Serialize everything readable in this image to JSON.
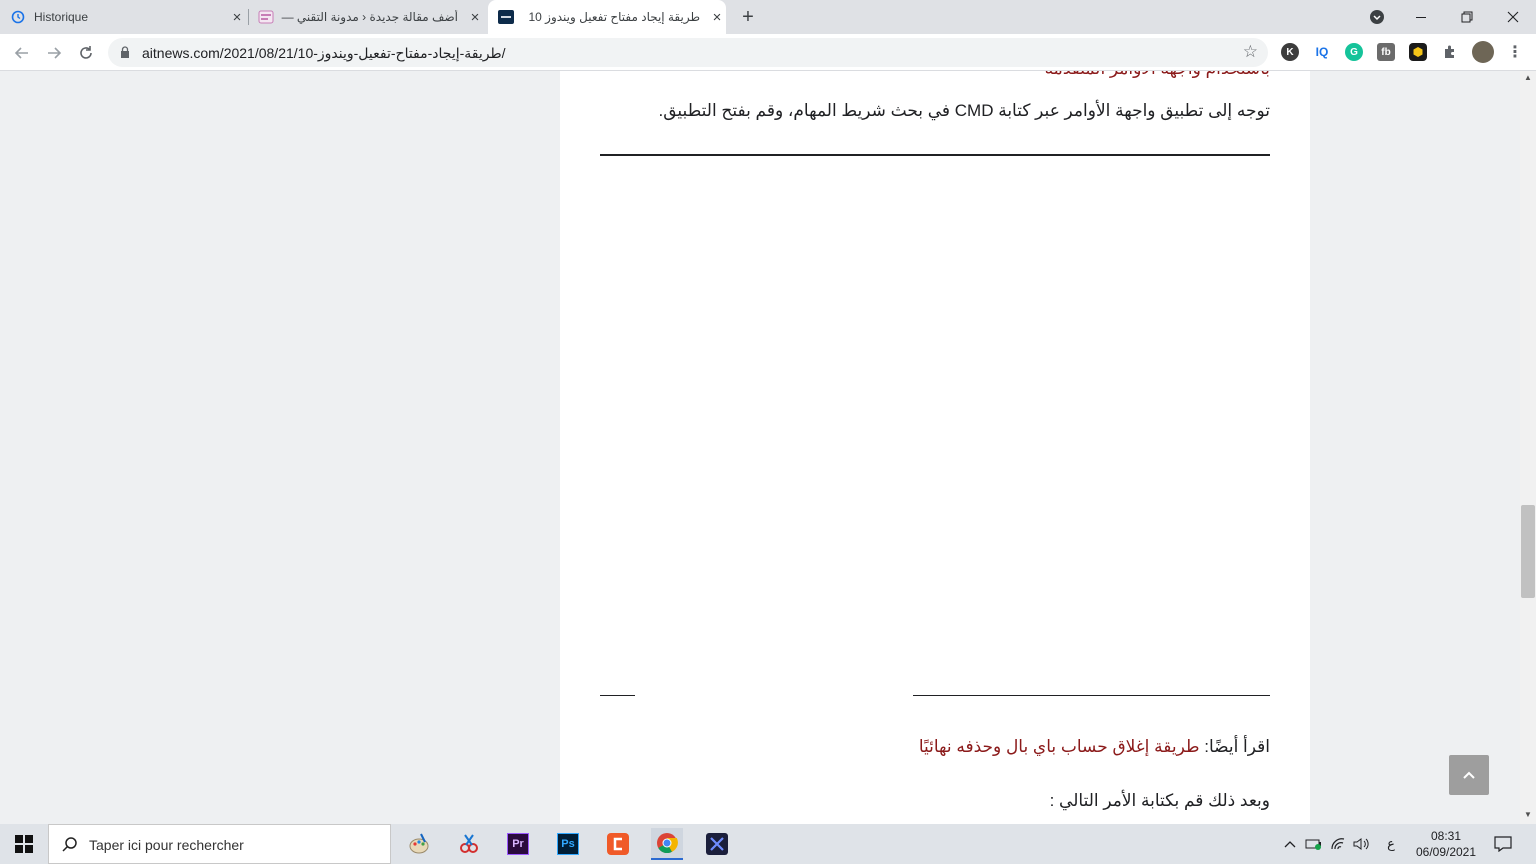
{
  "browser": {
    "tabs": [
      {
        "title": "Historique",
        "favicon": "history-icon",
        "active": false
      },
      {
        "title": "أضف مقالة جديدة ‹ مدونة التقني —",
        "favicon": "aitnews-blog-favicon",
        "active": false
      },
      {
        "title": "طريقة إيجاد مفتاح تفعيل ويندوز 10",
        "favicon": "aitnews-favicon",
        "active": true
      }
    ],
    "new_tab": "+",
    "url": "aitnews.com/2021/08/21/10-طريقة-إيجاد-مفتاح-تفعيل-ويندوز/",
    "extensions": [
      "K",
      "IQ",
      "G",
      "fb",
      "",
      ""
    ]
  },
  "article": {
    "cut_heading": "باستخدام واجهة الأوامر المتقدمة",
    "para1": "توجه إلى تطبيق واجهة الأوامر عبر كتابة CMD في بحث شريط المهام، وقم بفتح التطبيق.",
    "read_also_label": "اقرأ أيضًا:",
    "read_also_link": "طريقة إغلاق حساب باي بال وحذفه نهائيًا",
    "para2": "وبعد ذلك قم بكتابة الأمر التالي :",
    "colors": {
      "link": "#8b1a1a",
      "text": "#202124"
    }
  },
  "taskbar": {
    "search_placeholder": "Taper ici pour rechercher",
    "apps": [
      "paint-icon",
      "snipping-tool-icon",
      "premiere-pro-icon",
      "photoshop-icon",
      "camtasia-icon",
      "chrome-icon",
      "x-app-icon"
    ],
    "premiere_label": "Pr",
    "photoshop_label": "Ps",
    "input_lang": "ع",
    "time": "08:31",
    "date": "06/09/2021"
  }
}
